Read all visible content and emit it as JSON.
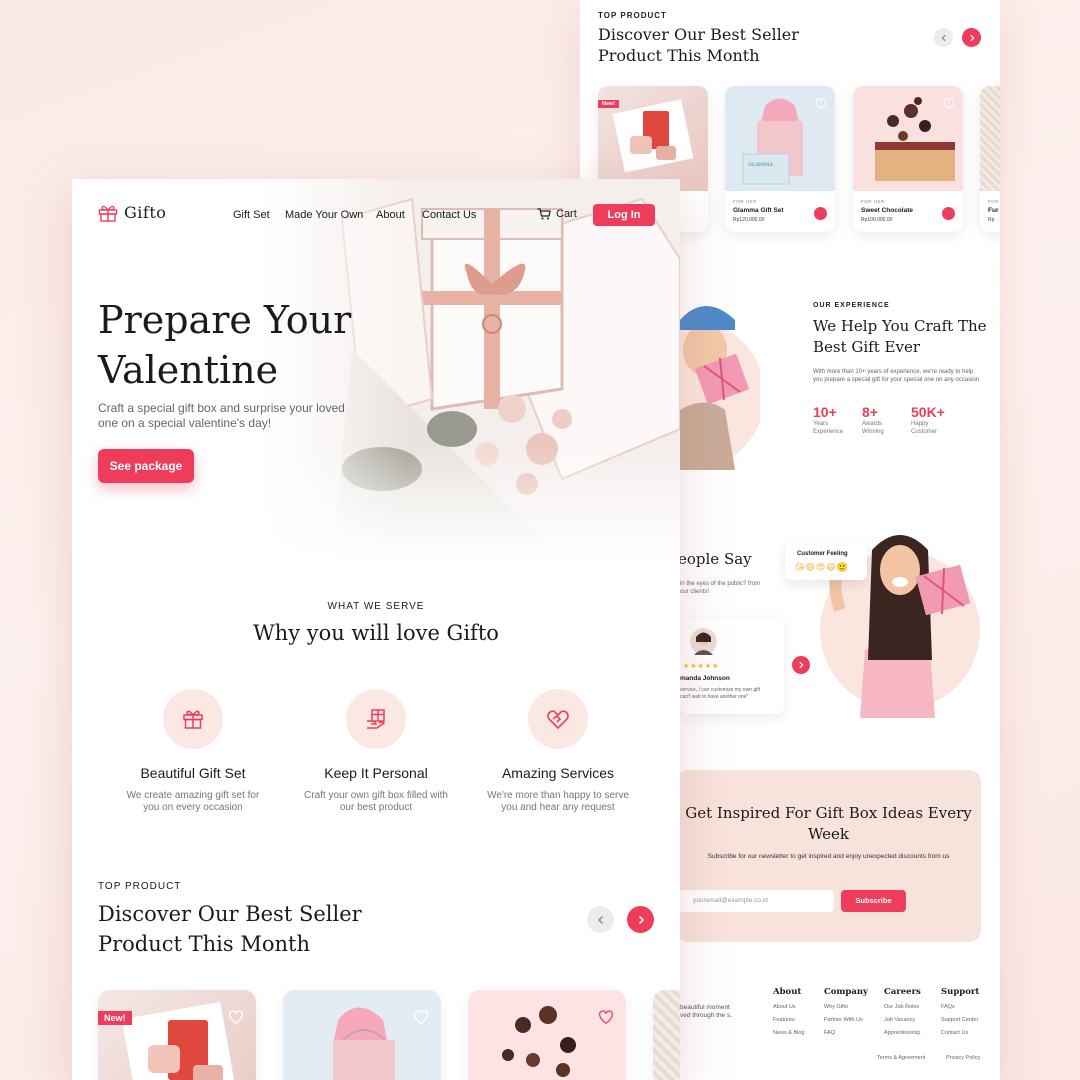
{
  "brand": {
    "name": "Gifto",
    "accent": "#ee3d5c",
    "soft": "#fbe8e3"
  },
  "nav": {
    "items": [
      "Gift Set",
      "Made Your Own",
      "About",
      "Contact Us"
    ],
    "cart": "Cart",
    "login": "Log In"
  },
  "hero": {
    "title": "Prepare Your Valentine",
    "desc": "Craft a special gift box and surprise your loved one on a special valentine's day!",
    "cta": "See package"
  },
  "serve": {
    "eyebrow": "WHAT WE SERVE",
    "title": "Why you will love Gifto",
    "features": [
      {
        "icon": "gift-icon",
        "title": "Beautiful Gift Set",
        "desc": "We create amazing gift set for you on every occasion"
      },
      {
        "icon": "gift-hand-icon",
        "title": "Keep It Personal",
        "desc": "Craft your own gift box filled with our best product"
      },
      {
        "icon": "heart-hands-icon",
        "title": "Amazing Services",
        "desc": "We're more than happy to serve you and hear any request"
      }
    ]
  },
  "top_product": {
    "eyebrow": "TOP PRODUCT",
    "title": "Discover Our Best Seller Product This Month",
    "new_badge": "New!",
    "products": [
      {
        "category": "",
        "name": "",
        "price": ""
      },
      {
        "category": "FOR HER",
        "name": "Glamma Gift Set",
        "price": "Rp120.000,00"
      },
      {
        "category": "FOR HER",
        "name": "Sweet Chocolate",
        "price": "Rp100.000,00"
      },
      {
        "category": "FOR",
        "name": "Fur",
        "price": "Rp"
      }
    ]
  },
  "experience": {
    "eyebrow": "OUR EXPERIENCE",
    "title": "We Help You Craft The Best Gift Ever",
    "desc": "With more than 10+ years of experience, we're ready to help you prepare a special gift for your special one on any occasion",
    "stats": [
      {
        "value": "10+",
        "label": "Years Experience"
      },
      {
        "value": "8+",
        "label": "Awards Winning"
      },
      {
        "value": "50K+",
        "label": "Happy Customer"
      }
    ]
  },
  "testimonial": {
    "title": "eople Say",
    "desc": "in the eyes of the public? from our clients!",
    "feeling_title": "Customer Feeling",
    "feeling_emoji": "😘😄😍😄🙂",
    "stars": "★★★★★",
    "name": "manda Johnson",
    "text": "service, I can customize my own gift can't wait to have another one\""
  },
  "newsletter": {
    "title": "Get Inspired For Gift Box Ideas Every Week",
    "desc": "Subscribe for our newsletter to get inspired and enjoy unexpected discounts from us",
    "placeholder": "youremail@example.co.id",
    "button": "Subscribe"
  },
  "footer": {
    "tagline": "beautiful moment ved through the s.",
    "columns": [
      {
        "title": "About",
        "links": [
          "About Us",
          "Features",
          "News & Blog"
        ]
      },
      {
        "title": "Company",
        "links": [
          "Why Gifto",
          "Partner With Us",
          "FAQ"
        ]
      },
      {
        "title": "Careers",
        "links": [
          "Our Job Roles",
          "Job Vacancy",
          "Apprenticeship"
        ]
      },
      {
        "title": "Support",
        "links": [
          "FAQs",
          "Support Center",
          "Contact Us"
        ]
      }
    ],
    "legal": [
      "Terms & Agreement",
      "Privacy Policy"
    ]
  }
}
